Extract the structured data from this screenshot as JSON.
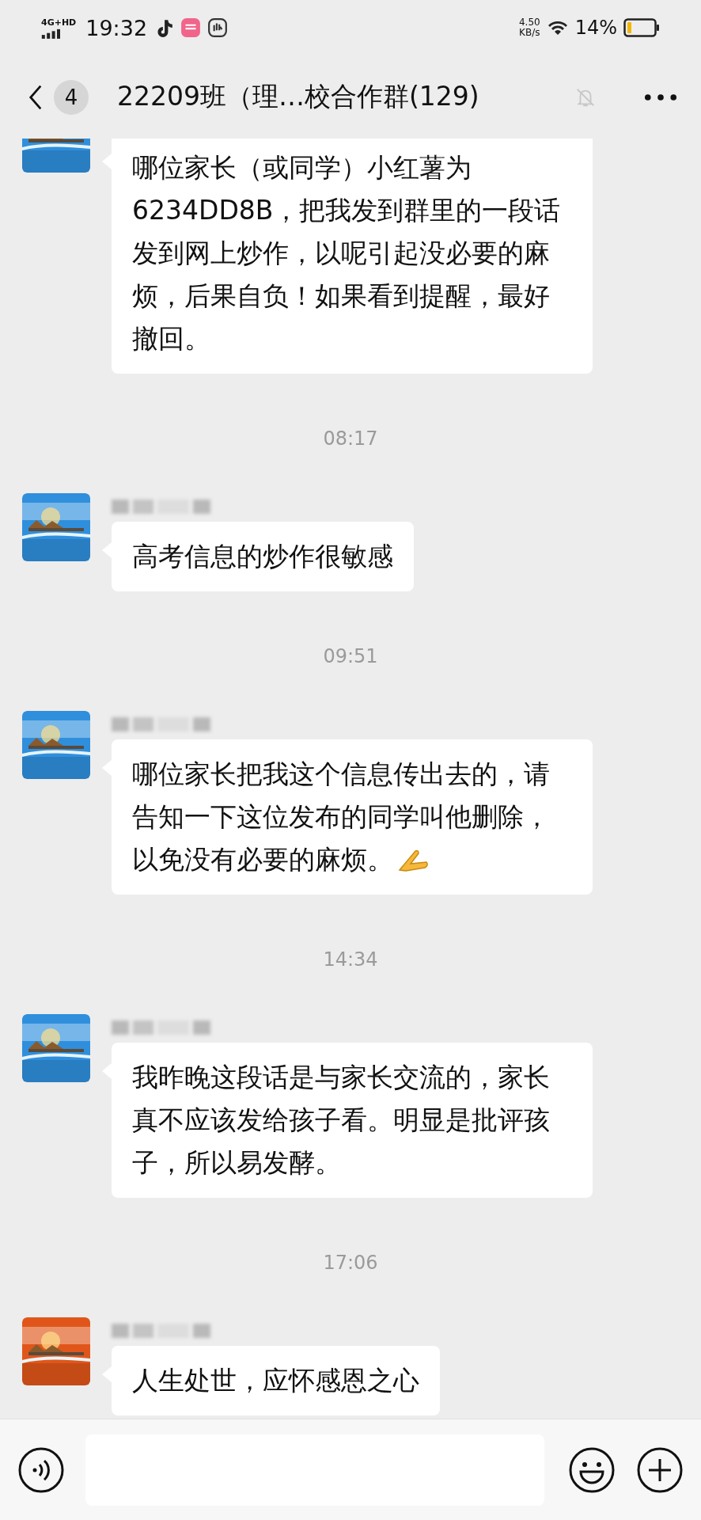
{
  "status_bar": {
    "network": "4G+HD",
    "time": "19:32",
    "speed_value": "4.50",
    "speed_unit": "KB/s",
    "battery": "14%"
  },
  "header": {
    "back_badge": "4",
    "title": "22209班（理…校合作群(129)",
    "muted": true
  },
  "items": [
    {
      "kind": "message",
      "name_blurred": false,
      "text": "哪位家长（或同学）小红薯为6234DD8B，把我发到群里的一段话发到网上炒作，以呢引起没必要的麻烦，后果自负！如果看到提醒，最好撤回。",
      "emoji": false
    },
    {
      "kind": "time",
      "text": "08:17"
    },
    {
      "kind": "message",
      "name_blurred": true,
      "text": "高考信息的炒作很敏感",
      "emoji": false
    },
    {
      "kind": "time",
      "text": "09:51"
    },
    {
      "kind": "message",
      "name_blurred": true,
      "text": "哪位家长把我这个信息传出去的，请告知一下这位发布的同学叫他删除，以免没有必要的麻烦。",
      "emoji": true
    },
    {
      "kind": "time",
      "text": "14:34"
    },
    {
      "kind": "message",
      "name_blurred": true,
      "text": "我昨晚这段话是与家长交流的，家长真不应该发给孩子看。明显是批评孩子，所以易发酵。",
      "emoji": false
    },
    {
      "kind": "time",
      "text": "17:06"
    },
    {
      "kind": "message",
      "name_blurred": true,
      "text": "人生处世，应怀感恩之心",
      "emoji": false
    }
  ]
}
